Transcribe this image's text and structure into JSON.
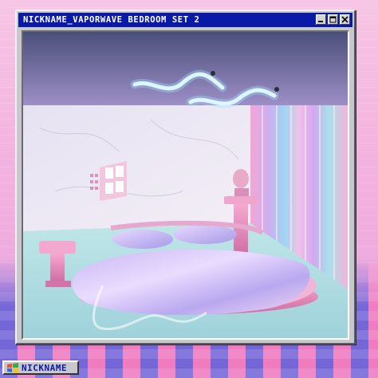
{
  "window": {
    "title": "NICKNAME_VAPORWAVE BEDROOM SET 2",
    "controls": {
      "minimize_icon": "minimize-icon",
      "maximize_icon": "maximize-icon",
      "close_icon": "close-icon"
    }
  },
  "taskbar": {
    "start_label": "NICKNAME",
    "start_icon": "windows-logo-icon"
  },
  "colors": {
    "titlebar": "#0b1aa6",
    "window_frame": "#c8c8cc",
    "accent_pink": "#f2a0d8",
    "accent_blue": "#5462dc"
  }
}
